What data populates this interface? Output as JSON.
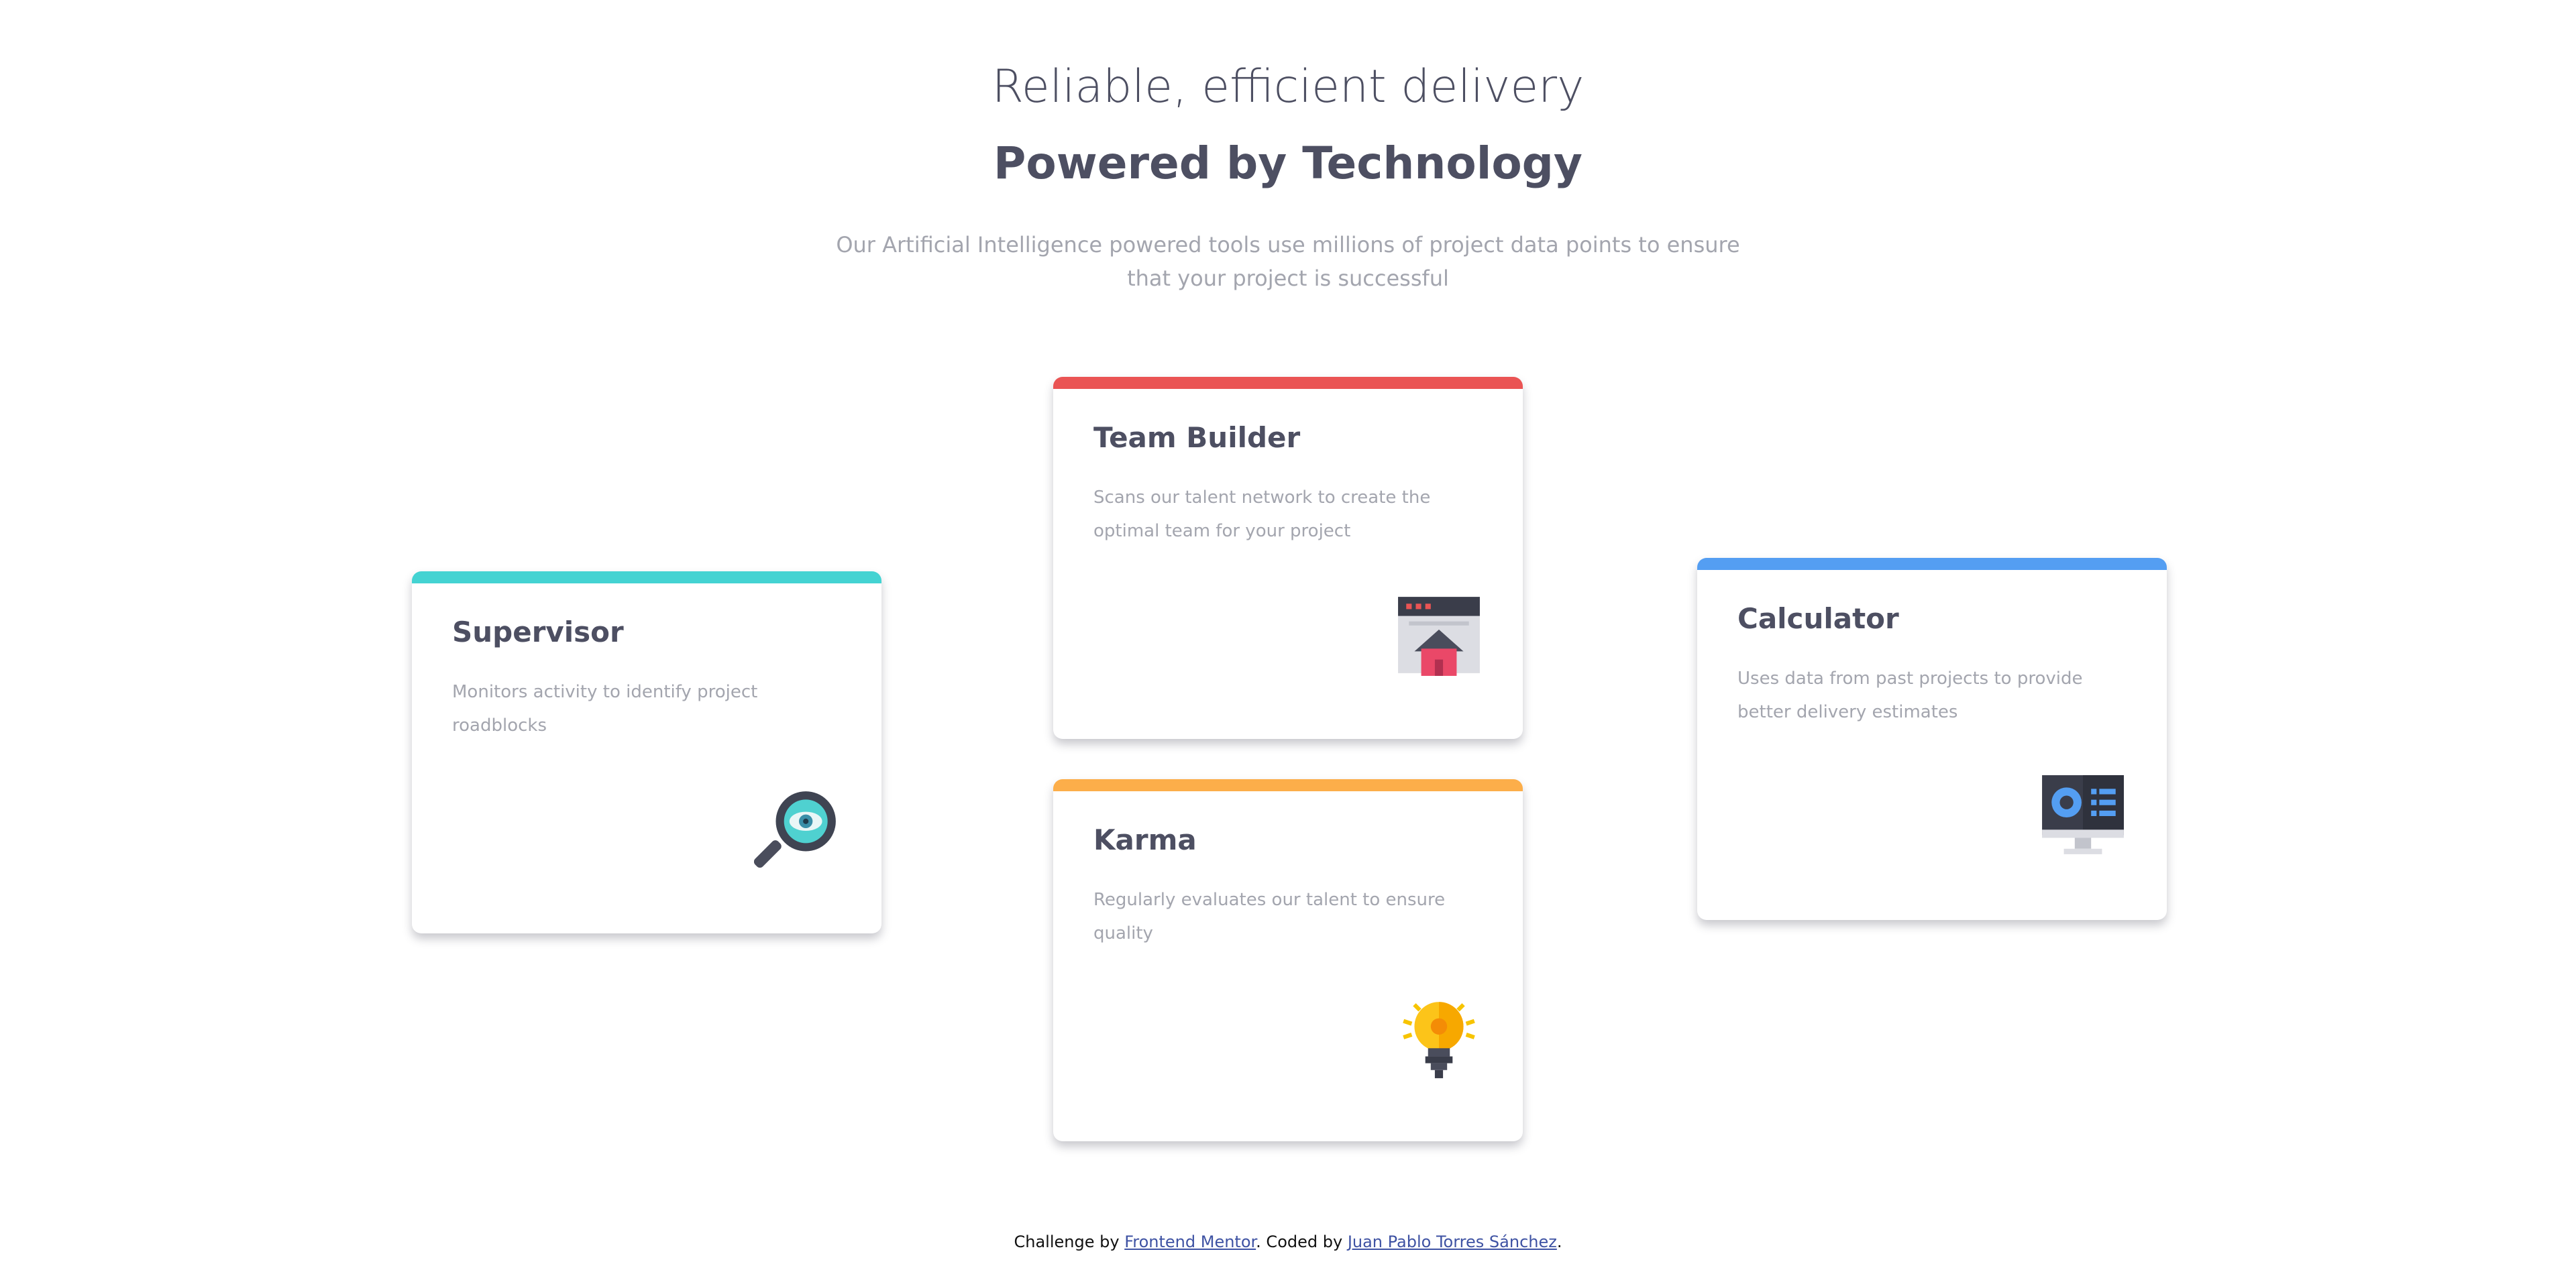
{
  "header": {
    "subtitle": "Reliable, efficient delivery",
    "title": "Powered by Technology",
    "intro": "Our Artificial Intelligence powered tools use millions of project data points to ensure that your project is successful"
  },
  "cards": [
    {
      "title": "Supervisor",
      "description": "Monitors activity to identify project roadblocks",
      "accent": "#44d3d2",
      "icon": "magnifier-eye-icon"
    },
    {
      "title": "Team Builder",
      "description": "Scans our talent network to create the optimal team for your project",
      "accent": "#ea5454",
      "icon": "team-builder-icon"
    },
    {
      "title": "Karma",
      "description": "Regularly evaluates our talent to ensure quality",
      "accent": "#fcae4a",
      "icon": "lightbulb-icon"
    },
    {
      "title": "Calculator",
      "description": "Uses data from past projects to provide better delivery estimates",
      "accent": "#549ef2",
      "icon": "monitor-dashboard-icon"
    }
  ],
  "footer": {
    "prefix": "Challenge by ",
    "link1": "Frontend Mentor",
    "middle": ". Coded by ",
    "link2": "Juan Pablo Torres Sánchez",
    "suffix": "."
  }
}
